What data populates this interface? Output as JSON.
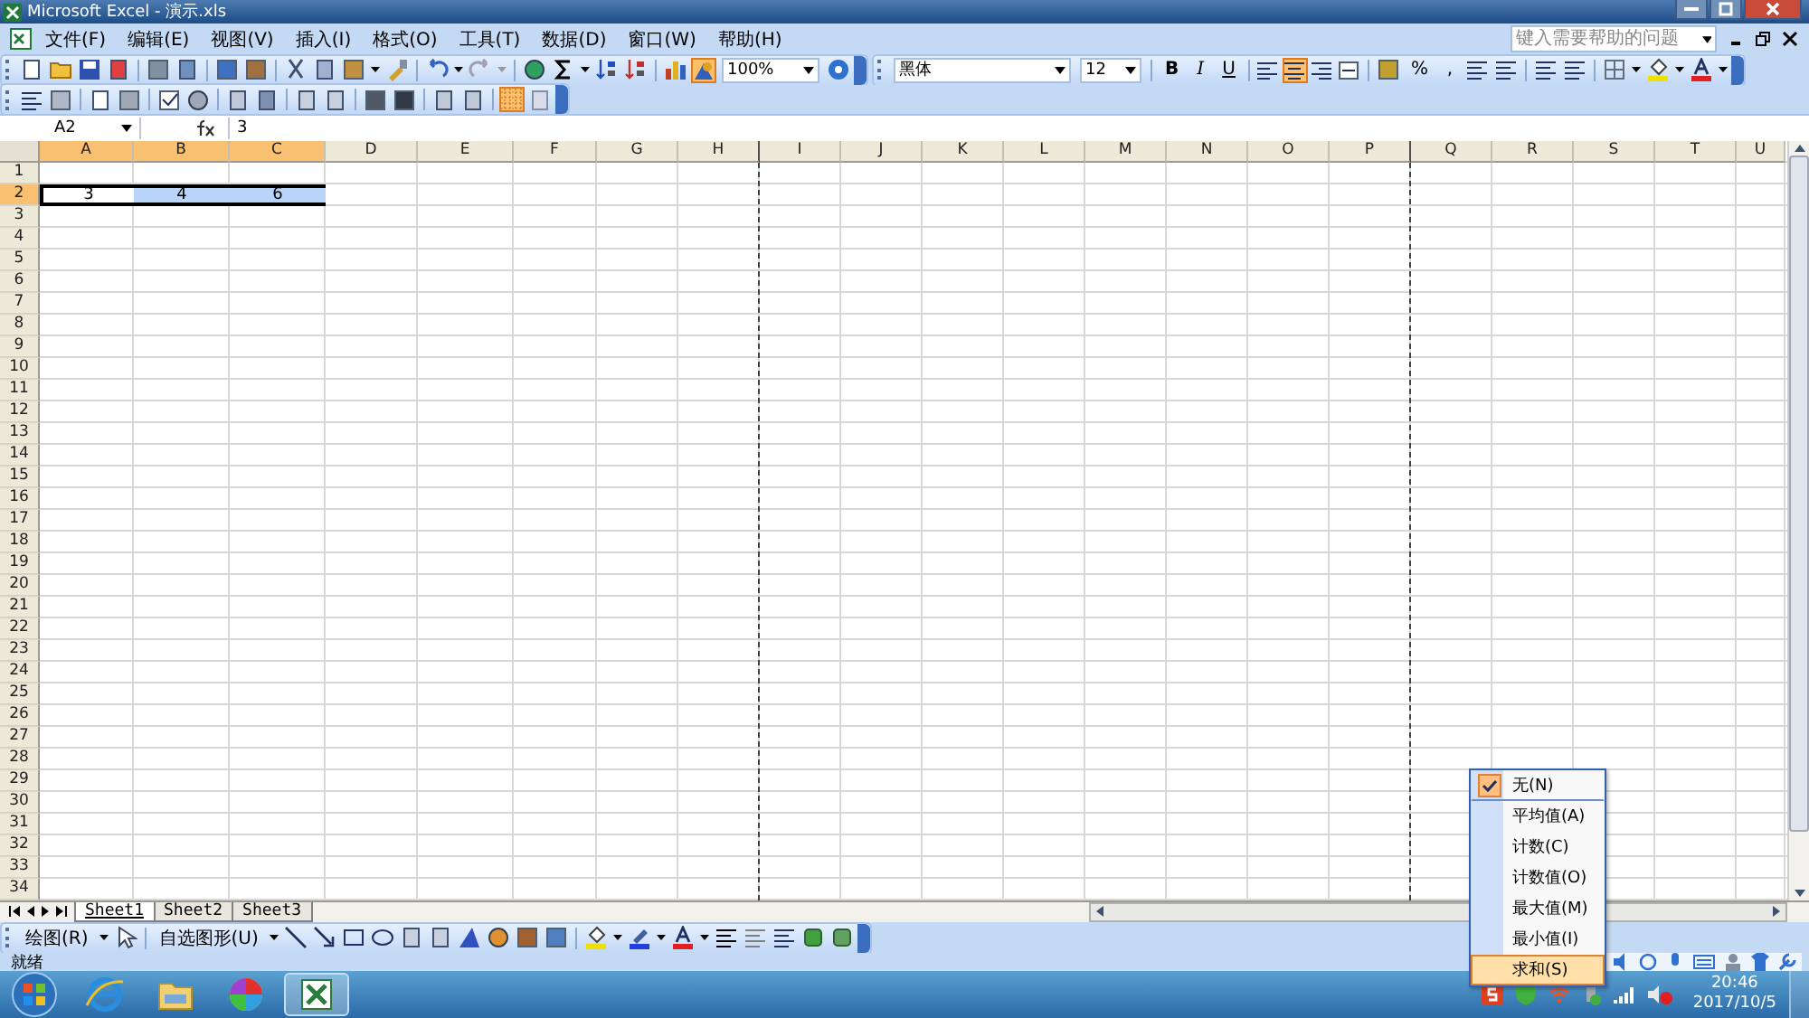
{
  "window": {
    "title": "Microsoft Excel - 演示.xls"
  },
  "menu_bar": [
    "文件(F)",
    "编辑(E)",
    "视图(V)",
    "插入(I)",
    "格式(O)",
    "工具(T)",
    "数据(D)",
    "窗口(W)",
    "帮助(H)"
  ],
  "help_search": {
    "placeholder": "键入需要帮助的问题"
  },
  "standard_toolbar": {
    "zoom": "100%",
    "drawing_toggle_on": true
  },
  "formatting_toolbar": {
    "font": "黑体",
    "size": "12",
    "style_buttons": [
      "B",
      "I",
      "U"
    ],
    "alignment_buttons": [
      {
        "selected": false
      },
      {
        "selected": true
      },
      {
        "selected": false
      },
      {
        "selected": false
      }
    ],
    "number_buttons": [
      "%",
      ","
    ]
  },
  "forms_toolbar": {
    "grid_toggle_on": true
  },
  "formula_bar": {
    "name_box": "A2",
    "value": "3"
  },
  "sheet": {
    "columns": [
      {
        "label": "A",
        "selected": true,
        "page_break": false
      },
      {
        "label": "B",
        "selected": true,
        "page_break": false
      },
      {
        "label": "C",
        "selected": true,
        "page_break": false
      },
      {
        "label": "D",
        "selected": false,
        "page_break": false
      },
      {
        "label": "E",
        "selected": false,
        "page_break": false
      },
      {
        "label": "F",
        "selected": false,
        "page_break": false
      },
      {
        "label": "G",
        "selected": false,
        "page_break": false
      },
      {
        "label": "H",
        "selected": false,
        "page_break": true
      },
      {
        "label": "I",
        "selected": false,
        "page_break": false
      },
      {
        "label": "J",
        "selected": false,
        "page_break": false
      },
      {
        "label": "K",
        "selected": false,
        "page_break": false
      },
      {
        "label": "L",
        "selected": false,
        "page_break": false
      },
      {
        "label": "M",
        "selected": false,
        "page_break": false
      },
      {
        "label": "N",
        "selected": false,
        "page_break": false
      },
      {
        "label": "O",
        "selected": false,
        "page_break": false
      },
      {
        "label": "P",
        "selected": false,
        "page_break": true
      },
      {
        "label": "Q",
        "selected": false,
        "page_break": false
      },
      {
        "label": "R",
        "selected": false,
        "page_break": false
      },
      {
        "label": "S",
        "selected": false,
        "page_break": false
      },
      {
        "label": "T",
        "selected": false,
        "page_break": false
      },
      {
        "label": "U",
        "selected": false,
        "page_break": false
      }
    ],
    "rows": [
      {
        "label": "1",
        "selected": false,
        "cells": []
      },
      {
        "label": "2",
        "selected": true,
        "cells": [
          {
            "value": "3",
            "selected": true,
            "active": true
          },
          {
            "value": "4",
            "selected": true,
            "active": false
          },
          {
            "value": "6",
            "selected": true,
            "active": false
          }
        ]
      },
      {
        "label": "3",
        "selected": false,
        "cells": []
      },
      {
        "label": "4",
        "selected": false,
        "cells": []
      },
      {
        "label": "5",
        "selected": false,
        "cells": []
      },
      {
        "label": "6",
        "selected": false,
        "cells": []
      },
      {
        "label": "7",
        "selected": false,
        "cells": []
      },
      {
        "label": "8",
        "selected": false,
        "cells": []
      },
      {
        "label": "9",
        "selected": false,
        "cells": []
      },
      {
        "label": "10",
        "selected": false,
        "cells": []
      },
      {
        "label": "11",
        "selected": false,
        "cells": []
      },
      {
        "label": "12",
        "selected": false,
        "cells": []
      },
      {
        "label": "13",
        "selected": false,
        "cells": []
      },
      {
        "label": "14",
        "selected": false,
        "cells": []
      },
      {
        "label": "15",
        "selected": false,
        "cells": []
      },
      {
        "label": "16",
        "selected": false,
        "cells": []
      },
      {
        "label": "17",
        "selected": false,
        "cells": []
      },
      {
        "label": "18",
        "selected": false,
        "cells": []
      },
      {
        "label": "19",
        "selected": false,
        "cells": []
      },
      {
        "label": "20",
        "selected": false,
        "cells": []
      },
      {
        "label": "21",
        "selected": false,
        "cells": []
      },
      {
        "label": "22",
        "selected": false,
        "cells": []
      },
      {
        "label": "23",
        "selected": false,
        "cells": []
      },
      {
        "label": "24",
        "selected": false,
        "cells": []
      },
      {
        "label": "25",
        "selected": false,
        "cells": []
      },
      {
        "label": "26",
        "selected": false,
        "cells": []
      },
      {
        "label": "27",
        "selected": false,
        "cells": []
      },
      {
        "label": "28",
        "selected": false,
        "cells": []
      },
      {
        "label": "29",
        "selected": false,
        "cells": []
      },
      {
        "label": "30",
        "selected": false,
        "cells": []
      },
      {
        "label": "31",
        "selected": false,
        "cells": []
      },
      {
        "label": "32",
        "selected": false,
        "cells": []
      },
      {
        "label": "33",
        "selected": false,
        "cells": []
      },
      {
        "label": "34",
        "selected": false,
        "cells": []
      }
    ]
  },
  "sheet_tabs": [
    {
      "label": "Sheet1",
      "selected": true
    },
    {
      "label": "Sheet2",
      "selected": false
    },
    {
      "label": "Sheet3",
      "selected": false
    }
  ],
  "drawing_toolbar": {
    "draw_menu": "绘图(R)",
    "autoshapes": "自选图形(U)"
  },
  "status_bar": {
    "text": "就绪"
  },
  "context_menu": {
    "items": [
      {
        "label": "无(N)",
        "checked": true,
        "selected": false
      },
      {
        "label": "平均值(A)",
        "checked": false,
        "selected": false
      },
      {
        "label": "计数(C)",
        "checked": false,
        "selected": false
      },
      {
        "label": "计数值(O)",
        "checked": false,
        "selected": false
      },
      {
        "label": "最大值(M)",
        "checked": false,
        "selected": false
      },
      {
        "label": "最小值(I)",
        "checked": false,
        "selected": false
      },
      {
        "label": "求和(S)",
        "checked": false,
        "selected": true
      }
    ]
  },
  "taskbar": {
    "apps": [
      {
        "kind": "browser",
        "selected": false
      },
      {
        "kind": "folder",
        "selected": false
      },
      {
        "kind": "pinwheel",
        "selected": false
      },
      {
        "kind": "excel",
        "selected": true
      }
    ],
    "time": "20:46",
    "date": "2017/10/5"
  }
}
